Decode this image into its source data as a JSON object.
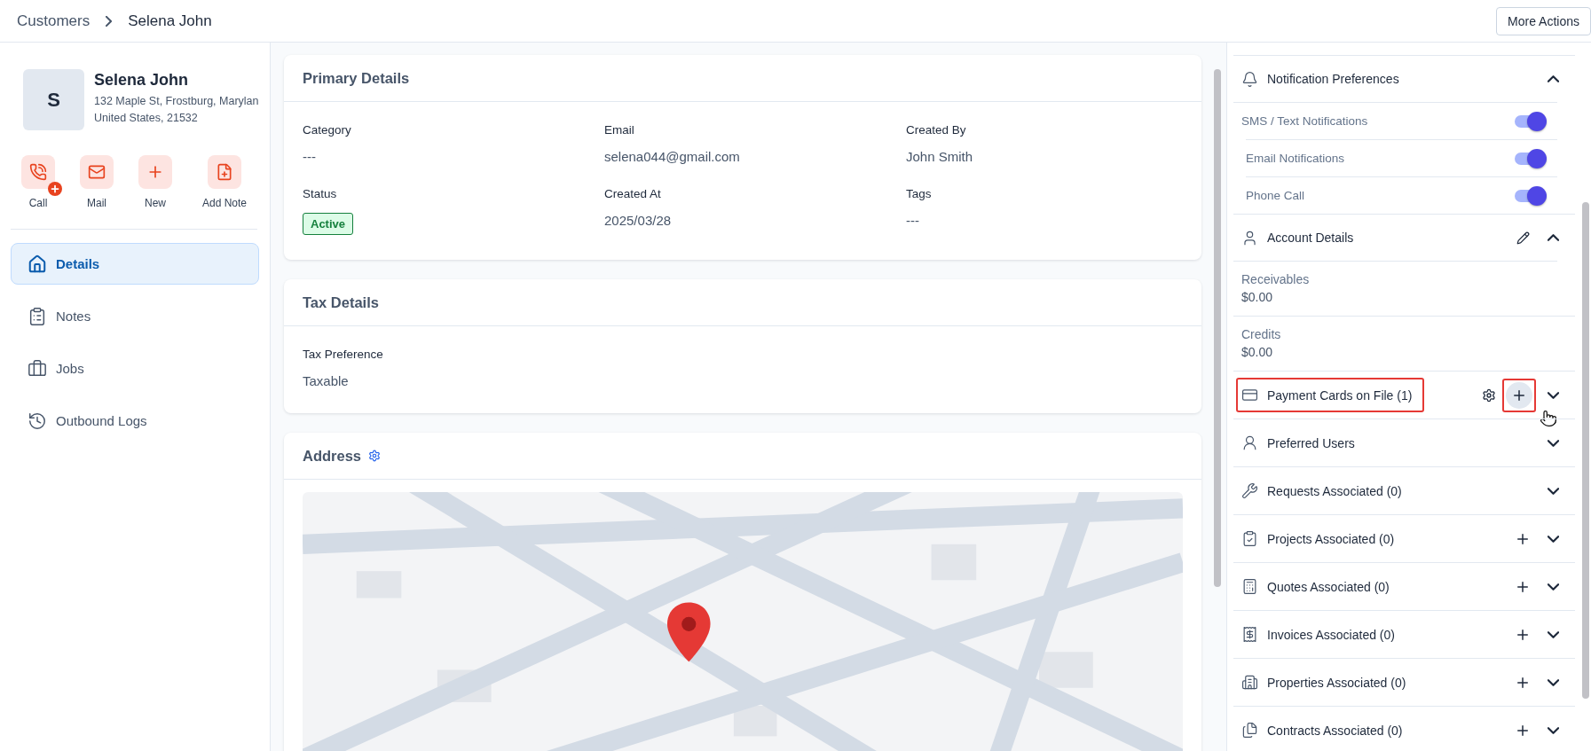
{
  "breadcrumb": [
    {
      "label": "Customers"
    },
    {
      "label": "Selena John"
    }
  ],
  "header_actions": [
    "More Actions"
  ],
  "profile": {
    "initial": "S",
    "name": "Selena John",
    "address_lines": [
      "132 Maple St, Frostburg, Marylan",
      "United States, 21532"
    ]
  },
  "quick_actions": [
    {
      "kind": "call",
      "label": "Call"
    },
    {
      "kind": "mail",
      "label": "Mail"
    },
    {
      "kind": "new",
      "label": "New"
    },
    {
      "kind": "note",
      "label": "Add Note"
    }
  ],
  "nav": [
    {
      "kind": "details",
      "label": "Details",
      "selected": true
    },
    {
      "kind": "notes",
      "label": "Notes",
      "selected": false
    },
    {
      "kind": "jobs",
      "label": "Jobs",
      "selected": false
    },
    {
      "kind": "logs",
      "label": "Outbound Logs",
      "selected": false
    }
  ],
  "cards": [
    {
      "title": "Primary Details",
      "fields": [
        {
          "label": "Category",
          "value": "---",
          "kind": "text"
        },
        {
          "label": "Email",
          "value": "selena044@gmail.com",
          "kind": "text"
        },
        {
          "label": "Created By",
          "value": "John Smith",
          "kind": "text"
        },
        {
          "label": "Status",
          "value": "Active",
          "kind": "badge"
        },
        {
          "label": "Created At",
          "value": "2025/03/28",
          "kind": "text"
        },
        {
          "label": "Tags",
          "value": "---",
          "kind": "text"
        }
      ]
    },
    {
      "title": "Tax Details",
      "fields": [
        {
          "label": "Tax Preference",
          "value": "Taxable",
          "kind": "text"
        }
      ]
    }
  ],
  "address": {
    "title": "Address"
  },
  "side_panel": {
    "notifications": {
      "title": "Notification Preferences",
      "expanded": true,
      "options": [
        {
          "label": "SMS / Text Notifications",
          "on": true
        },
        {
          "label": "Email Notifications",
          "on": true
        },
        {
          "label": "Phone Call",
          "on": true
        }
      ]
    },
    "account": {
      "title": "Account Details",
      "expanded": true,
      "items": [
        {
          "label": "Receivables",
          "value": "$0.00"
        },
        {
          "label": "Credits",
          "value": "$0.00"
        }
      ]
    },
    "sections": [
      {
        "kind": "payment",
        "title": "Payment Cards on File (1)",
        "settings": true,
        "add": true,
        "expanded": false,
        "highlighted": true
      },
      {
        "kind": "users",
        "title": "Preferred Users",
        "settings": false,
        "add": false,
        "expanded": false,
        "highlighted": false
      },
      {
        "kind": "requests",
        "title": "Requests Associated (0)",
        "settings": false,
        "add": false,
        "expanded": false,
        "highlighted": false
      },
      {
        "kind": "projects",
        "title": "Projects Associated (0)",
        "settings": false,
        "add": true,
        "expanded": false,
        "highlighted": false
      },
      {
        "kind": "quotes",
        "title": "Quotes Associated (0)",
        "settings": false,
        "add": true,
        "expanded": false,
        "highlighted": false
      },
      {
        "kind": "invoices",
        "title": "Invoices Associated (0)",
        "settings": false,
        "add": true,
        "expanded": false,
        "highlighted": false
      },
      {
        "kind": "properties",
        "title": "Properties Associated (0)",
        "settings": false,
        "add": true,
        "expanded": false,
        "highlighted": false
      },
      {
        "kind": "contracts",
        "title": "Contracts Associated (0)",
        "settings": false,
        "add": true,
        "expanded": false,
        "highlighted": false
      }
    ]
  }
}
